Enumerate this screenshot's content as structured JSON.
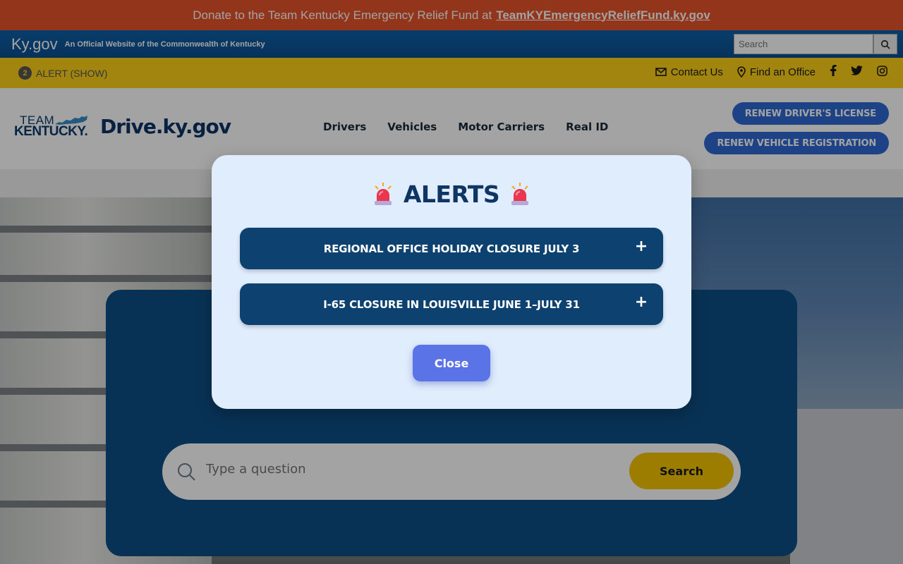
{
  "donate_banner": {
    "text": "Donate to the Team Kentucky Emergency Relief Fund at",
    "link": "TeamKYEmergencyReliefFund.ky.gov"
  },
  "kygov_bar": {
    "logo": "Ky.gov",
    "tagline": "An Official Website of the Commonwealth of Kentucky",
    "search_placeholder": "Search",
    "search_icon": "search-icon"
  },
  "utility_bar": {
    "alert_count": "2",
    "alert_label": "ALERT (SHOW)",
    "contact": "Contact Us",
    "find_office": "Find an Office",
    "social_icons": [
      "facebook-icon",
      "twitter-icon",
      "instagram-icon"
    ]
  },
  "header": {
    "logo_top": "TEAM",
    "logo_bottom": "KENTUCKY.",
    "site_name": "Drive.ky.gov",
    "nav": [
      "Drivers",
      "Vehicles",
      "Motor Carriers",
      "Real ID"
    ],
    "cta_license": "RENEW DRIVER'S LICENSE",
    "cta_registration": "RENEW VEHICLE REGISTRATION"
  },
  "hero": {
    "search_placeholder": "Type a question",
    "search_button": "Search"
  },
  "modal": {
    "title": "ALERTS",
    "alerts": [
      "REGIONAL OFFICE HOLIDAY CLOSURE JULY 3",
      "I-65 CLOSURE IN LOUISVILLE JUNE 1–JULY 31"
    ],
    "expand_symbol": "+",
    "close_label": "Close"
  },
  "colors": {
    "donate_bg": "#e4532a",
    "kygov_bg": "#0a4f8f",
    "utility_bg": "#fcd116",
    "brand_navy": "#0d3566",
    "cta_blue": "#2f68d2",
    "modal_bg": "#e0edfd",
    "accordion_bg": "#0d4170",
    "close_bg": "#5a73e6",
    "search_button_bg": "#f5c400"
  }
}
